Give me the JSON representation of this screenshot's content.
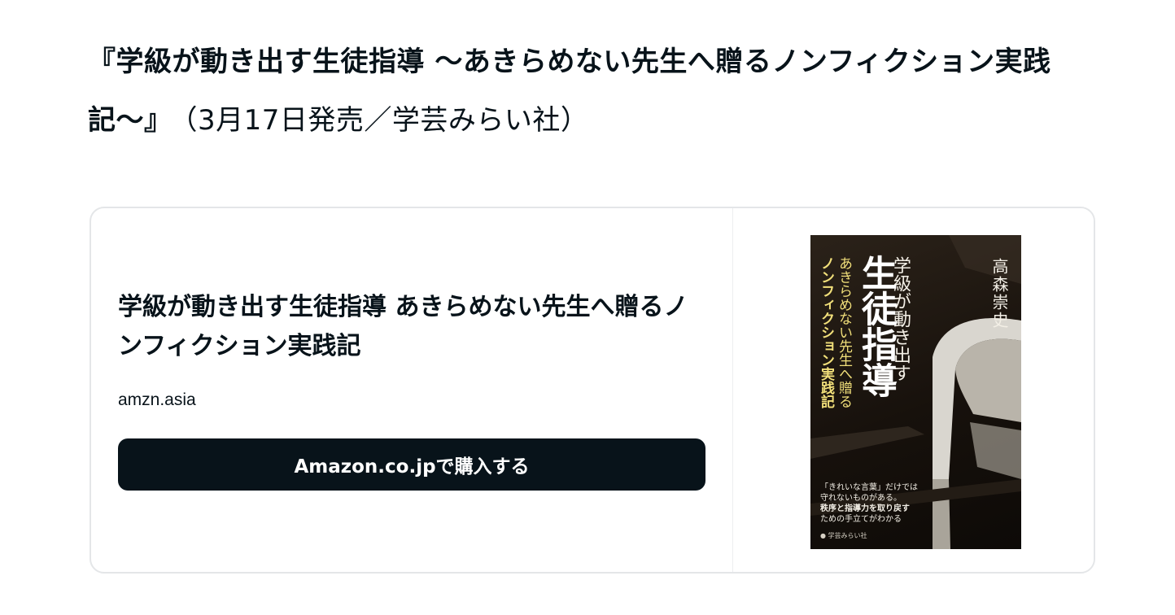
{
  "headline": {
    "title": "『学級が動き出す生徒指導 〜あきらめない先生へ贈るノンフィクション実践記〜』",
    "meta": "（3月17日発売／学芸みらい社）"
  },
  "card": {
    "title": "学級が動き出す生徒指導 あきらめない先生へ贈るノンフィクション実践記",
    "domain": "amzn.asia",
    "button_label": "Amazon.co.jpで購入する",
    "button_color": "#08131a",
    "border_color": "#e4e6e8"
  },
  "cover": {
    "author": "高森崇史",
    "title_top": "学級が動き出す",
    "title_big": "生徒指導",
    "subtitle_1": "あきらめない先生へ贈る",
    "subtitle_2": "ノンフィクション実践記",
    "blurb_1": "「きれいな言葉」だけでは",
    "blurb_2": "守れないものがある。",
    "blurb_3": "秩序と指導力を取り戻す",
    "blurb_4": "ための手立てがわかる",
    "publisher": "学芸みらい社",
    "accent_color": "#f1df7a"
  }
}
